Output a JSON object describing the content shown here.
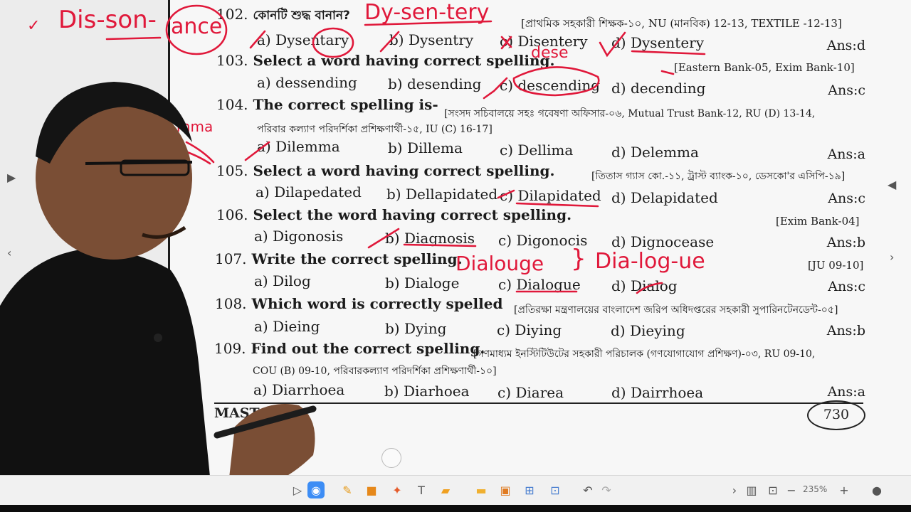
{
  "questions": [
    {
      "num": "102.",
      "text": "কোনটি শুদ্ধ বানান?",
      "source": "[প্রাথমিক সহকারী শিক্ষক-১০, NU (মানবিক) 12-13, TEXTILE -12-13]",
      "options": [
        [
          "a)",
          "Dysentary"
        ],
        [
          "b)",
          "Dysentry"
        ],
        [
          "c)",
          "Disentery"
        ],
        [
          "d)",
          "Dysentery"
        ]
      ],
      "answer": "Ans:d"
    },
    {
      "num": "103.",
      "text": "Select a word having correct spelling.",
      "source": "[Eastern Bank-05, Exim Bank-10]",
      "options": [
        [
          "a)",
          "dessending"
        ],
        [
          "b)",
          "desending"
        ],
        [
          "c)",
          "descending"
        ],
        [
          "d)",
          "decending"
        ]
      ],
      "answer": "Ans:c"
    },
    {
      "num": "104.",
      "text": "The correct spelling is-",
      "source": "[সংসদ সচিবালয়ে সহঃ গবেষণা অফিসার-০৬, Mutual Trust Bank-12, RU (D) 13-14,",
      "source2": "পরিবার কল্যাণ পরিদর্শিকা প্রশিক্ষণার্থী-১৫, IU (C) 16-17]",
      "options": [
        [
          "a)",
          "Dilemma"
        ],
        [
          "b)",
          "Dillema"
        ],
        [
          "c)",
          "Dellima"
        ],
        [
          "d)",
          "Delemma"
        ]
      ],
      "answer": "Ans:a"
    },
    {
      "num": "105.",
      "text": "Select a word having correct spelling.",
      "source": "[তিতাস গ্যাস কো.-১১, ট্রাস্ট ব্যাংক-১০, ডেসকো'র এসিপি-১৯]",
      "options": [
        [
          "a)",
          "Dilapedated"
        ],
        [
          "b)",
          "Dellapidated"
        ],
        [
          "c)",
          "Dilapidated"
        ],
        [
          "d)",
          "Delapidated"
        ]
      ],
      "answer": "Ans:c"
    },
    {
      "num": "106.",
      "text": "Select the word having correct spelling.",
      "source": "[Exim Bank-04]",
      "options": [
        [
          "a)",
          "Digonosis"
        ],
        [
          "b)",
          "Diagnosis"
        ],
        [
          "c)",
          "Digonocis"
        ],
        [
          "d)",
          "Dignocease"
        ]
      ],
      "answer": "Ans:b"
    },
    {
      "num": "107.",
      "text": "Write the correct spelling.",
      "source": "[JU 09-10]",
      "options": [
        [
          "a)",
          "Dilog"
        ],
        [
          "b)",
          "Dialoge"
        ],
        [
          "c)",
          "Dialogue"
        ],
        [
          "d)",
          "Dialog"
        ]
      ],
      "answer": "Ans:c"
    },
    {
      "num": "108.",
      "text": "Which word is correctly spelled",
      "source": "[প্রতিরক্ষা মন্ত্রণালয়ের বাংলাদেশ জরিপ অধিদপ্তরের সহকারী সুপারিনটেনডেন্ট-০৫]",
      "options": [
        [
          "a)",
          "Dieing"
        ],
        [
          "b)",
          "Dying"
        ],
        [
          "c)",
          "Diying"
        ],
        [
          "d)",
          "Dieying"
        ]
      ],
      "answer": "Ans:b"
    },
    {
      "num": "109.",
      "text": "Find out the correct spelling.",
      "source": "[গণমাধ্যম ইনস্টিটিউটের সহকারী পরিচালক (গণযোগাযোগ প্রশিক্ষণ)-০৩, RU 09-10,",
      "source2": "COU (B) 09-10, পরিবারকল্যাণ পরিদর্শিকা প্রশিক্ষণার্থী-১০]",
      "options": [
        [
          "a)",
          "Diarrhoea"
        ],
        [
          "b)",
          "Diarhoea"
        ],
        [
          "c)",
          "Diarea"
        ],
        [
          "d)",
          "Dairrhoea"
        ]
      ],
      "answer": "Ans:a"
    }
  ],
  "footer": {
    "left": "MAST",
    "page": "730"
  },
  "annotations": {
    "dysentery_split": "Dy-sen-tery",
    "left_note_1": "Dis-son-",
    "left_note_2": "ance",
    "check_mark": "✓",
    "dese": "dese",
    "dialouge": "Dialouge",
    "dia_log_ue": "Dia-log-ue",
    "brace": "}",
    "mma": "mma"
  },
  "toolbar": {
    "zoom": "235%"
  },
  "colors": {
    "ink": "#e0183a",
    "board": "#f3f3f3"
  }
}
